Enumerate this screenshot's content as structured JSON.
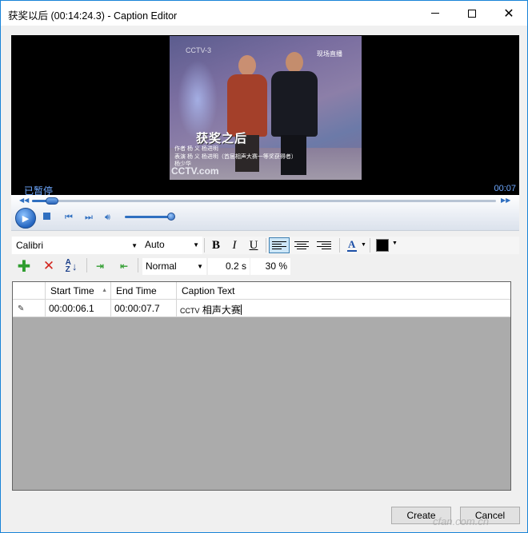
{
  "window": {
    "title": "获奖以后 (00:14:24.3) - Caption Editor",
    "minimize_label": "",
    "maximize_label": "",
    "close_label": "✕"
  },
  "video": {
    "overlay_logo_top": "CCTV-3",
    "overlay_live": "现场直播",
    "overlay_title": "获奖之后",
    "overlay_credit_1": "作者  杨  义  杨进明",
    "overlay_credit_2": "表演  杨  义  杨进明（首届相声大赛一等奖获得者）",
    "overlay_credit_3": "杨少华",
    "overlay_logo_bottom": "CCTV.com",
    "status": "已暂停",
    "elapsed": "00:07"
  },
  "transport": {
    "seek_position": 0.03,
    "volume": 0.9,
    "icons": [
      "rewind-icon",
      "fast-forward-icon",
      "play-icon",
      "stop-icon",
      "previous-icon",
      "next-icon",
      "volume-icon"
    ]
  },
  "format_bar": {
    "font": "Calibri",
    "size": "Auto",
    "bold": "B",
    "italic": "I",
    "underline": "U",
    "font_color_glyph": "A",
    "background_color": "#000000",
    "active_alignment": "left"
  },
  "edit_bar": {
    "style": "Normal",
    "duration": "0.2 s",
    "opacity": "30 %",
    "icons": [
      "add-icon",
      "delete-icon",
      "sort-az-icon",
      "shift-down-icon",
      "shift-up-icon"
    ]
  },
  "grid": {
    "columns": [
      "Start Time",
      "End Time",
      "Caption Text"
    ],
    "rows": [
      {
        "marker": "✎",
        "start": "00:00:06.1",
        "end": "00:00:07.7",
        "text_prefix": "CCTV",
        "text": " 相声大赛"
      }
    ]
  },
  "buttons": {
    "create": "Create",
    "cancel": "Cancel"
  },
  "watermark": "cfan.com.cn"
}
